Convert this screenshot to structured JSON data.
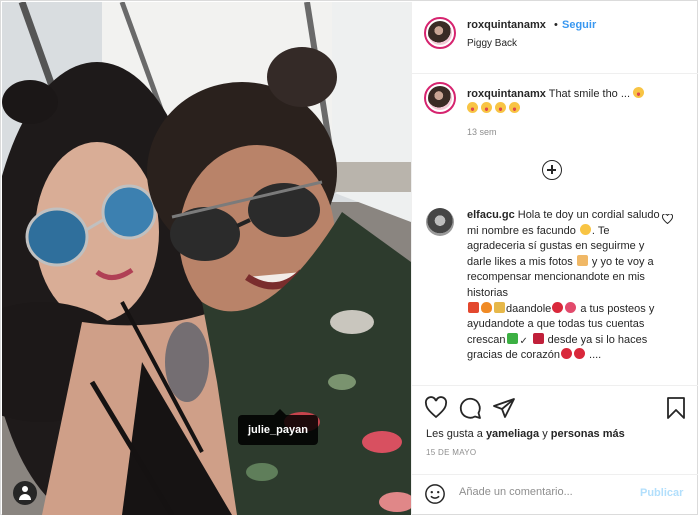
{
  "post": {
    "username": "roxquintanamx",
    "follow_label": "Seguir",
    "dot": "•",
    "subtitle": "Piggy Back",
    "photo_tag": "julie_payan"
  },
  "caption": {
    "username": "roxquintanamx",
    "text": "That smile tho ...",
    "time": "13 sem"
  },
  "comment": {
    "username": "elfacu.gc",
    "line1": "Hola te doy un cordial saludo mi nombre es facundo",
    "line2": ". Te agradeceria sí gustas en seguirme y darle likes a mis fotos",
    "line3": " y yo te voy a recompensar mencionandote en mis historias",
    "line4": "daandole",
    "line5": " a tus posteos y ayudandote a que todas tus cuentas crescan",
    "line6": "desde ya si lo haces gracias de corazón",
    "line7": "...."
  },
  "likes": {
    "prefix": "Les gusta a",
    "user": "yameliaga",
    "middle": "y",
    "others": "personas más"
  },
  "date": "15 DE MAYO",
  "add_comment": {
    "placeholder": "Añade un comentario...",
    "publish_label": "Publicar"
  },
  "icons": {
    "like": "heart-icon",
    "comment": "comment-icon",
    "share": "share-icon",
    "save": "bookmark-icon",
    "emoji": "smile-icon",
    "tag": "user-icon",
    "more": "plus-circle-icon"
  },
  "colors": {
    "follow": "#3897f0",
    "publish_disabled": "#b2dffc",
    "story_ring": "#d6246f",
    "muted": "#8e8e8e"
  }
}
